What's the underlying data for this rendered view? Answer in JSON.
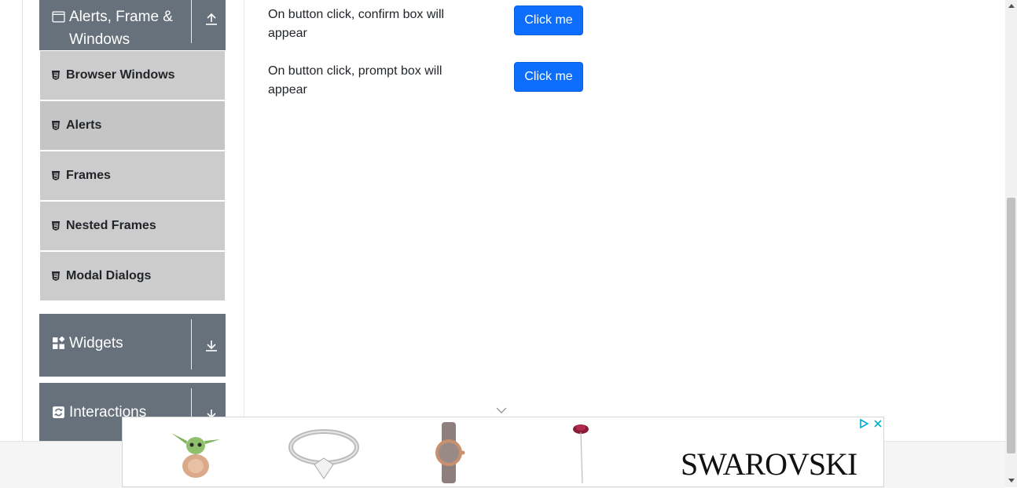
{
  "sidebar": {
    "alerts_group": {
      "title": "Alerts, Frame & Windows",
      "icon": "browser-window-icon",
      "toggle_icon": "upload-arrow-icon"
    },
    "items": [
      {
        "label": "Browser Windows",
        "icon": "html5-icon"
      },
      {
        "label": "Alerts",
        "icon": "html5-icon"
      },
      {
        "label": "Frames",
        "icon": "html5-icon"
      },
      {
        "label": "Nested Frames",
        "icon": "html5-icon"
      },
      {
        "label": "Modal Dialogs",
        "icon": "html5-icon"
      }
    ],
    "widgets_group": {
      "title": "Widgets",
      "icon": "widgets-grid-icon",
      "toggle_icon": "download-arrow-icon"
    },
    "interactions_group": {
      "title": "Interactions",
      "icon": "interactions-icon",
      "toggle_icon": "download-arrow-icon"
    }
  },
  "main": {
    "rows": [
      {
        "text": "On button click, confirm box will appear",
        "button_label": "Click me"
      },
      {
        "text": "On button click, prompt box will appear",
        "button_label": "Click me"
      }
    ]
  },
  "ad": {
    "brand": "SWAROVSKI",
    "colors": {
      "adchoices": "#00aecd"
    }
  },
  "colors": {
    "sidebar_header": "#66717b",
    "menu_item": "#cccccc",
    "button": "#0d6efd"
  }
}
